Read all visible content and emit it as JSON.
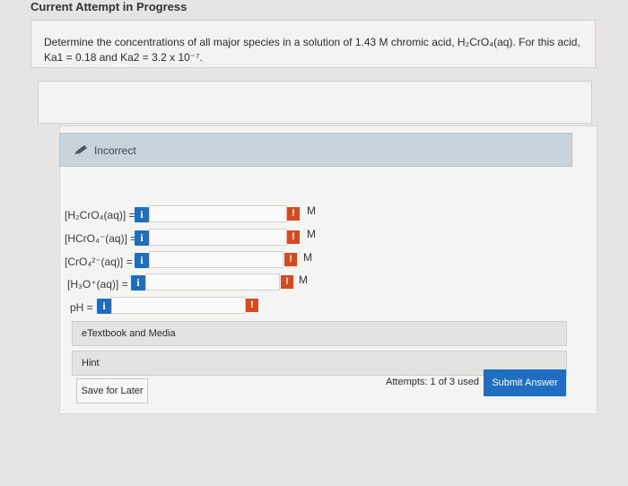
{
  "page": {
    "title": "Current Attempt in Progress",
    "question": "Determine the concentrations of all major species in a solution of 1.43 M chromic acid, H₂CrO₄(aq). For this acid, Ka1 = 0.18 and Ka2 = 3.2 x 10⁻⁷."
  },
  "feedback": {
    "label": "Incorrect"
  },
  "rows": [
    {
      "label": "[H₂CrO₄(aq)] =",
      "value": "",
      "unit": "M"
    },
    {
      "label": "[HCrO₄⁻(aq)] =",
      "value": "",
      "unit": "M"
    },
    {
      "label": "[CrO₄²⁻(aq)] =",
      "value": "",
      "unit": "M"
    },
    {
      "label": "[H₃O⁺(aq)] =",
      "value": "",
      "unit": "M"
    },
    {
      "label": "pH =",
      "value": "",
      "unit": ""
    }
  ],
  "icons": {
    "info": "i",
    "warning": "!"
  },
  "resources": {
    "etextbook": "eTextbook and Media",
    "hint": "Hint"
  },
  "footer": {
    "save_label": "Save for Later",
    "attempts": "Attempts: 1 of 3 used",
    "submit_label": "Submit Answer"
  },
  "colors": {
    "primary": "#1e6fc2",
    "warning": "#d64a1d",
    "banner": "#c8d3dc"
  }
}
